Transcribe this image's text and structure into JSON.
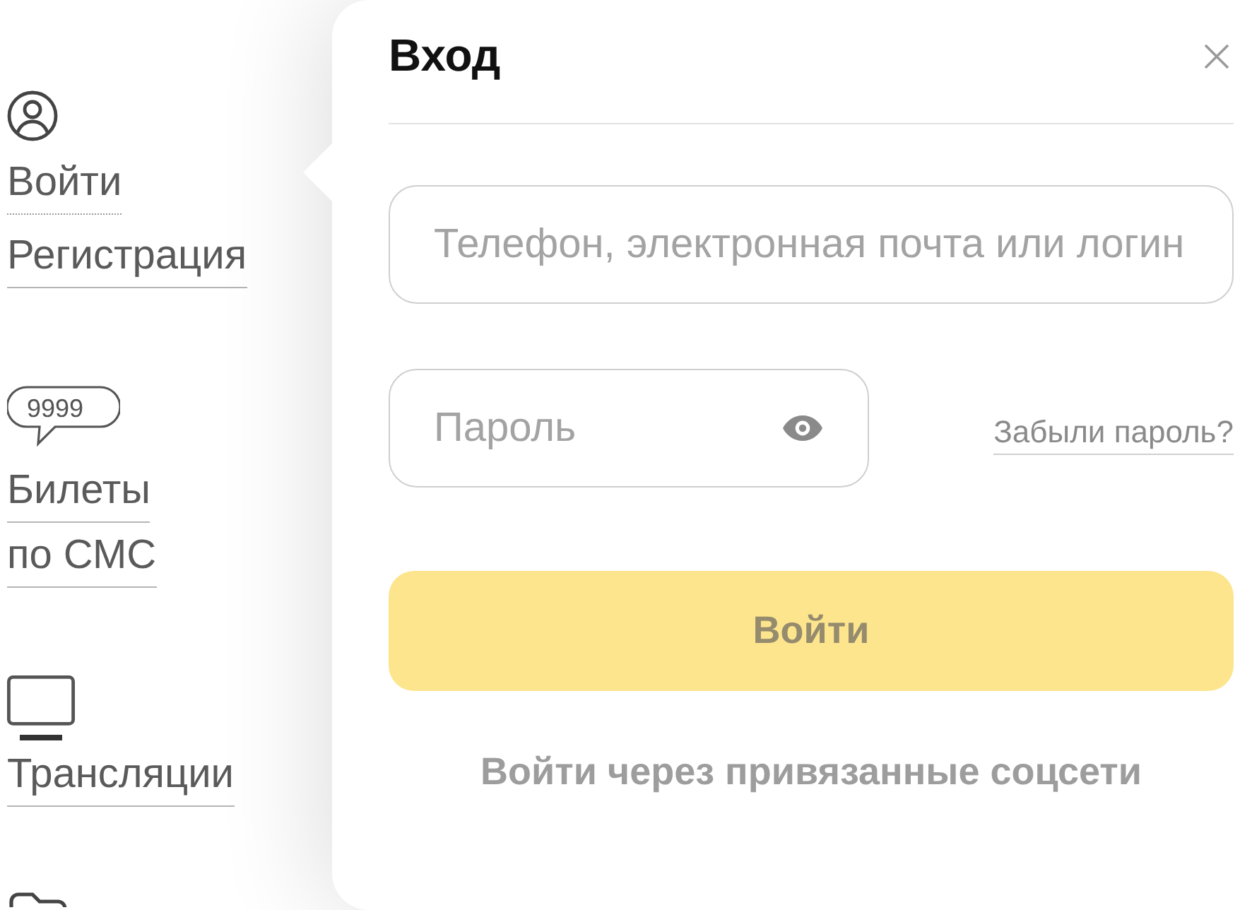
{
  "sidebar": {
    "groups": [
      {
        "kind": "account",
        "links": [
          {
            "label": "Войти",
            "kind": "action"
          },
          {
            "label": "Регистрация",
            "kind": "link"
          }
        ]
      },
      {
        "kind": "sms",
        "badge": "9999",
        "links": [
          {
            "label": "Билеты",
            "kind": "link"
          },
          {
            "label": "по СМС",
            "kind": "link"
          }
        ]
      },
      {
        "kind": "broadcast",
        "links": [
          {
            "label": "Трансляции",
            "kind": "link"
          }
        ]
      },
      {
        "kind": "folder"
      }
    ]
  },
  "dialog": {
    "title": "Вход",
    "login_field": {
      "placeholder": "Телефон, электронная почта или логин"
    },
    "password_field": {
      "placeholder": "Пароль"
    },
    "forgot_link": "Забыли пароль?",
    "submit": {
      "label": "Войти",
      "disabled": true
    },
    "social_link": "Войти через привязанные соцсети"
  }
}
